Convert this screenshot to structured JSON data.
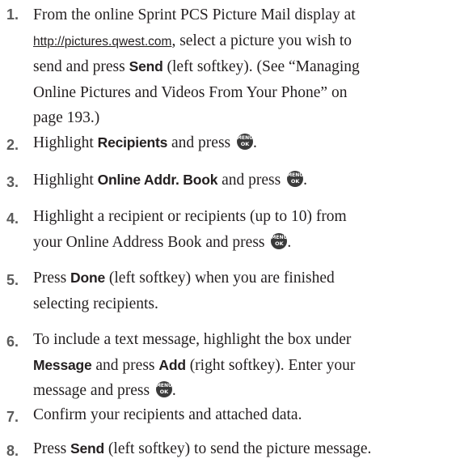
{
  "menu_ok_key": {
    "line1": "MENU",
    "line2": "OK"
  },
  "steps": [
    {
      "number": "1.",
      "l1": "From the online Sprint PCS Picture Mail display at",
      "url": "http://pictures.qwest.com",
      "l2_after_url": ", select a picture you wish to",
      "l3_pre": "send and press ",
      "l3_bold": "Send",
      "l3_post": " (left softkey). (See “Managing",
      "l4": "Online Pictures and Videos From Your Phone” on",
      "l5": "page 193.)"
    },
    {
      "number": "2.",
      "pre": "Highlight ",
      "bold": "Recipients",
      "post": " and press "
    },
    {
      "number": "3.",
      "pre": "Highlight ",
      "bold": "Online Addr. Book",
      "post": " and press "
    },
    {
      "number": "4.",
      "l1": "Highlight a recipient or recipients (up to 10) from",
      "l2": "your Online Address Book and press "
    },
    {
      "number": "5.",
      "pre": "Press ",
      "bold": "Done",
      "post": " (left softkey) when you are finished",
      "l2": "selecting recipients."
    },
    {
      "number": "6.",
      "l1": "To include a text message, highlight the box under",
      "l2_bold1": "Message",
      "l2_mid": " and press ",
      "l2_bold2": "Add",
      "l2_post": " (right softkey). Enter your",
      "l3": "message and press "
    },
    {
      "number": "7.",
      "text": "Confirm your recipients and attached data."
    },
    {
      "number": "8.",
      "pre": "Press ",
      "bold": "Send",
      "post": " (left softkey) to send the picture message."
    }
  ]
}
